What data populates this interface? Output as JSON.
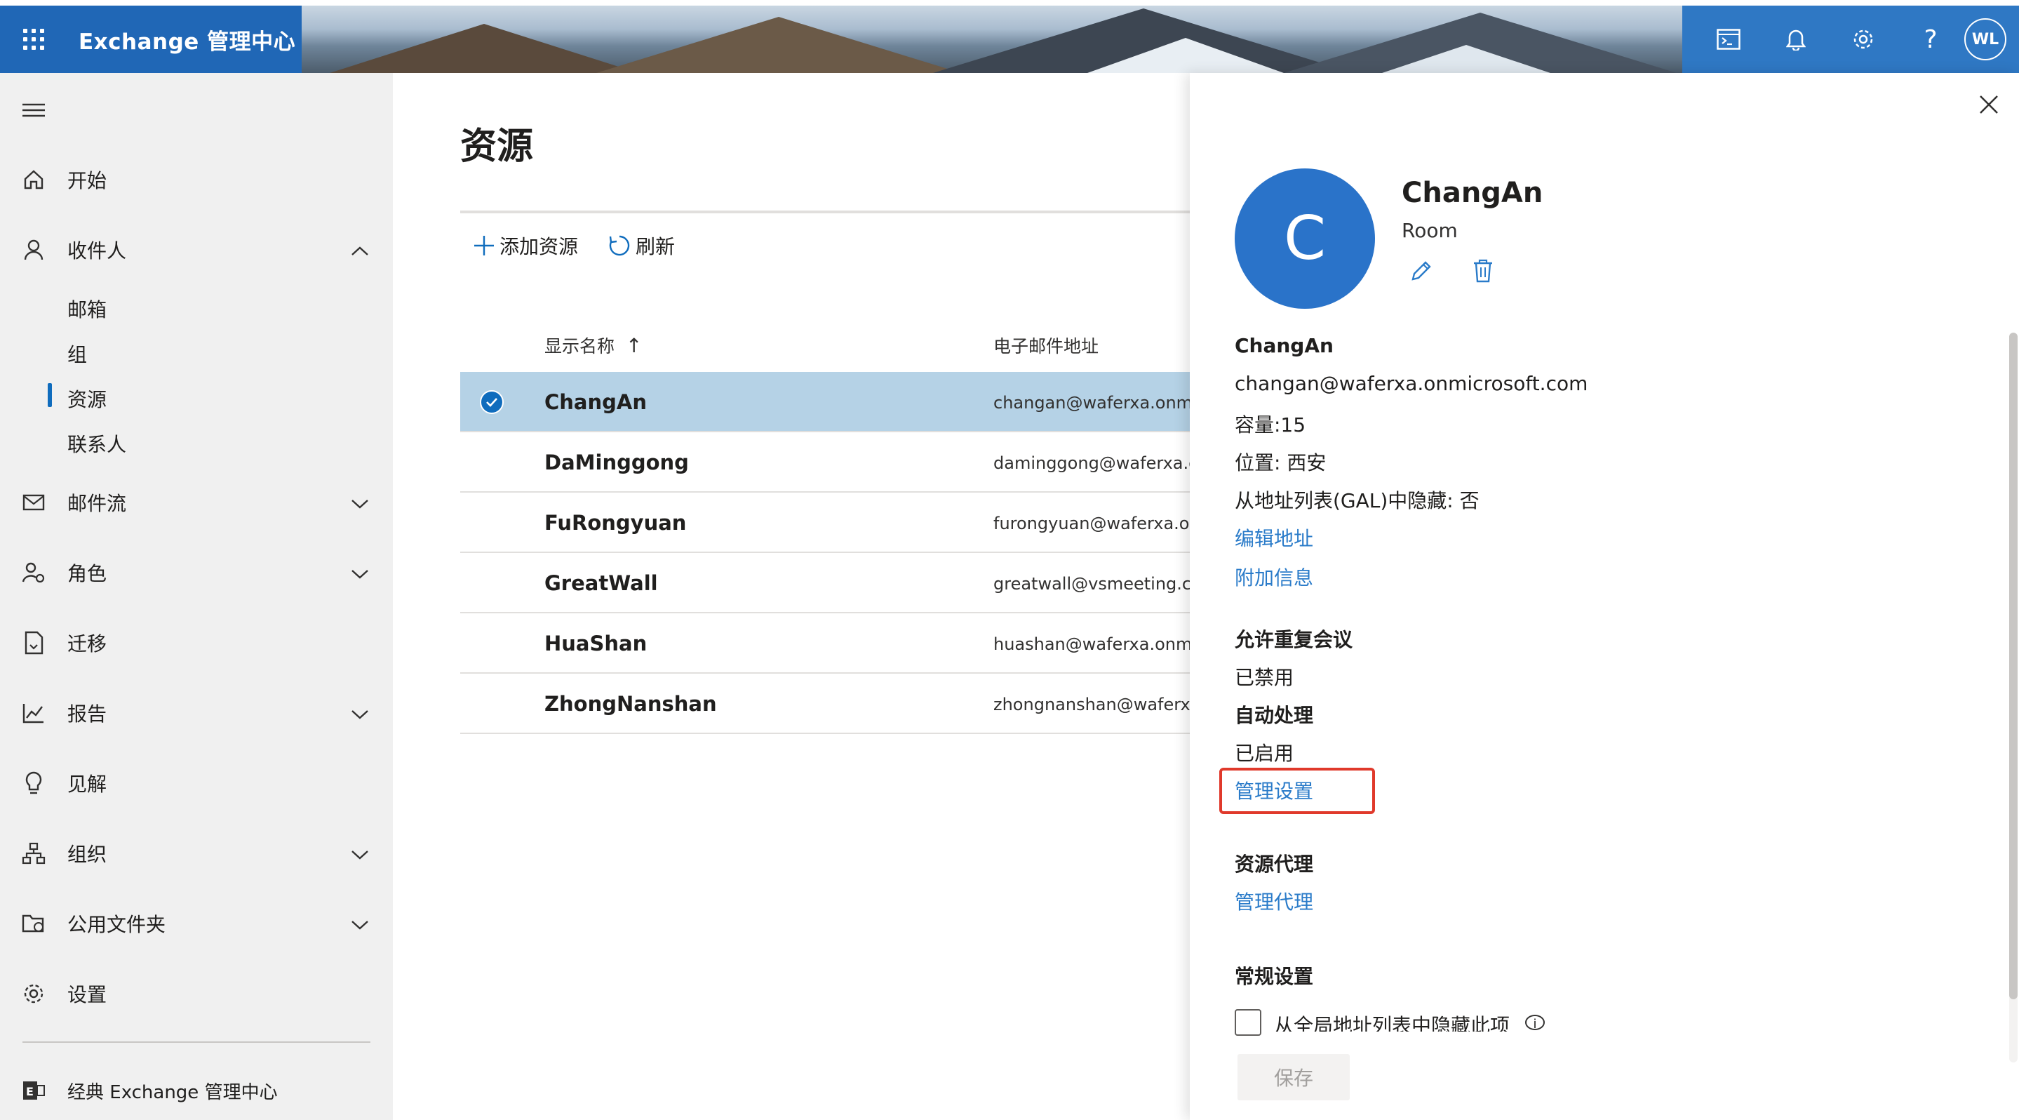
{
  "header": {
    "app_title": "Exchange 管理中心",
    "icons": [
      "waffle-icon",
      "terminal-icon",
      "bell-icon",
      "gear-icon",
      "help-icon"
    ],
    "avatar_initials": "WL",
    "brand_color": "#2067b6"
  },
  "sidebar": {
    "items": [
      {
        "label": "开始",
        "icon": "home-icon"
      },
      {
        "label": "收件人",
        "icon": "person-icon",
        "expanded": true
      },
      {
        "label": "邮件流",
        "icon": "mail-icon"
      },
      {
        "label": "角色",
        "icon": "roles-icon"
      },
      {
        "label": "迁移",
        "icon": "migration-icon"
      },
      {
        "label": "报告",
        "icon": "chart-icon"
      },
      {
        "label": "见解",
        "icon": "lightbulb-icon"
      },
      {
        "label": "组织",
        "icon": "org-icon"
      },
      {
        "label": "公用文件夹",
        "icon": "public-folder-icon"
      },
      {
        "label": "设置",
        "icon": "gear-icon"
      }
    ],
    "sub_items": [
      "邮箱",
      "组",
      "资源",
      "联系人"
    ],
    "active_sub_item": "资源",
    "classic_link": "经典 Exchange 管理中心"
  },
  "main": {
    "title": "资源",
    "commands": {
      "add": "添加资源",
      "refresh": "刷新"
    },
    "columns": {
      "name": "显示名称",
      "sort_arrow": "↑",
      "email": "电子邮件地址"
    },
    "rows": [
      {
        "name": "ChangAn",
        "email": "changan@waferxa.onmicro",
        "selected": true
      },
      {
        "name": "DaMinggong",
        "email": "daminggong@waferxa.onm",
        "selected": false
      },
      {
        "name": "FuRongyuan",
        "email": "furongyuan@waferxa.onm",
        "selected": false
      },
      {
        "name": "GreatWall",
        "email": "greatwall@vsmeeting.cn",
        "selected": false
      },
      {
        "name": "HuaShan",
        "email": "huashan@waferxa.onmicro",
        "selected": false
      },
      {
        "name": "ZhongNanshan",
        "email": "zhongnanshan@waferxa.o",
        "selected": false
      }
    ]
  },
  "panel": {
    "avatar_letter": "C",
    "name": "ChangAn",
    "type": "Room",
    "display_name": "ChangAn",
    "email": "changan@waferxa.onmicrosoft.com",
    "capacity": "容量:15",
    "location": "位置: 西安",
    "gal_hidden": "从地址列表(GAL)中隐藏: 否",
    "edit_address": "编辑地址",
    "additional_info": "附加信息",
    "recurring_heading": "允许重复会议",
    "recurring_value": "已禁用",
    "autoprocess_heading": "自动处理",
    "autoprocess_value": "已启用",
    "manage_settings": "管理设置",
    "delegates_heading": "资源代理",
    "manage_delegates": "管理代理",
    "general_heading": "常规设置",
    "hide_gal_checkbox": "从全局地址列表中隐藏此项",
    "save_button": "保存",
    "highlight_color": "#e0392b",
    "link_color": "#2a7bc9"
  }
}
